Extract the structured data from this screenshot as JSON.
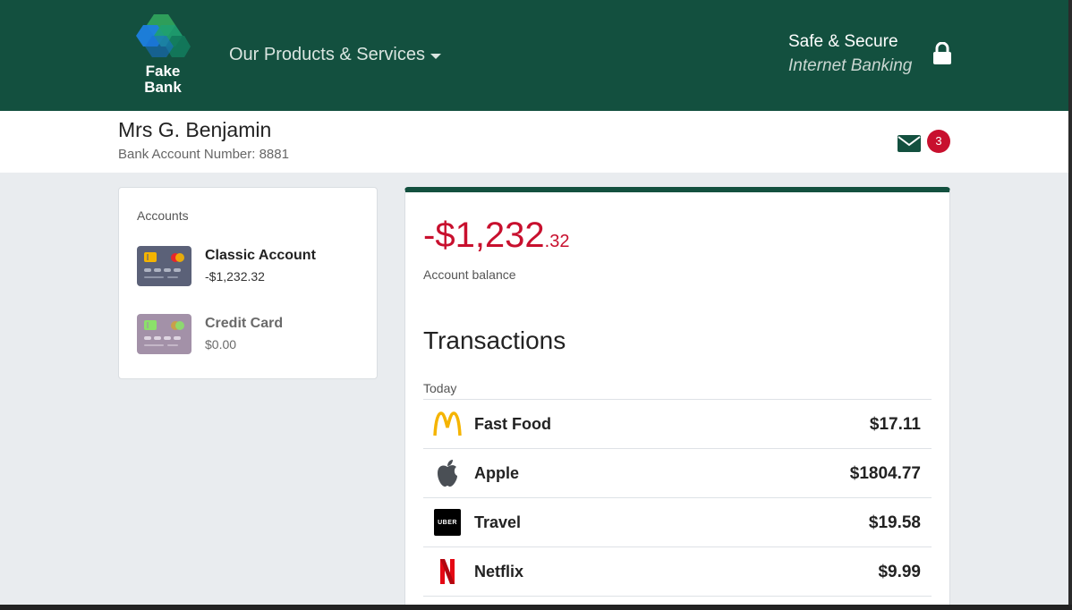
{
  "header": {
    "logo": {
      "line1": "Fake",
      "line2": "Bank"
    },
    "nav_products_label": "Our Products & Services",
    "secure_title": "Safe & Secure",
    "secure_subtitle": "Internet Banking",
    "brand_color": "#13503f"
  },
  "user": {
    "name": "Mrs G. Benjamin",
    "account_number_label": "Bank Account Number: 8881",
    "messages_icon": "envelope-icon",
    "unread_count": "3"
  },
  "accounts": {
    "heading": "Accounts",
    "items": [
      {
        "name": "Classic Account",
        "balance": "-$1,232.32",
        "icon": "credit-card-icon"
      },
      {
        "name": "Credit Card",
        "balance": "$0.00",
        "icon": "credit-card-icon"
      }
    ]
  },
  "balance": {
    "main": "-$1,232",
    "cents": ".32",
    "label": "Account balance",
    "color": "#c8102e"
  },
  "transactions": {
    "heading": "Transactions",
    "day_label": "Today",
    "rows": [
      {
        "name": "Fast Food",
        "amount": "$17.11",
        "icon": "mcdonalds-logo-icon"
      },
      {
        "name": "Apple",
        "amount": "$1804.77",
        "icon": "apple-logo-icon"
      },
      {
        "name": "Travel",
        "amount": "$19.58",
        "icon": "uber-logo-icon",
        "icon_text": "UBER"
      },
      {
        "name": "Netflix",
        "amount": "$9.99",
        "icon": "netflix-logo-icon"
      }
    ]
  }
}
